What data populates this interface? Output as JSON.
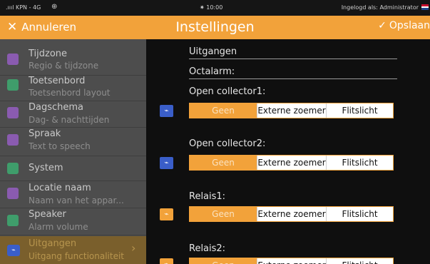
{
  "status_bar": {
    "carrier": ".ıııl KPN - 4G",
    "globe_icon": "globe-icon",
    "time": "10:00",
    "login_text": "Ingelogd als: Administrator"
  },
  "top_bar": {
    "cancel_label": "Annuleren",
    "title": "Instellingen",
    "save_label": "Opslaan"
  },
  "sidebar": {
    "items": [
      {
        "title": "Tijdzone",
        "subtitle": "Regio & tijdzone",
        "icon": "globe-icon",
        "color": "#8a5bb0"
      },
      {
        "title": "Toetsenbord",
        "subtitle": "Toetsenbord layout",
        "icon": "keyboard-icon",
        "color": "#3f9d6b"
      },
      {
        "title": "Dagschema",
        "subtitle": "Dag- & nachttijden",
        "icon": "sun-icon",
        "color": "#8a5bb0"
      },
      {
        "title": "Spraak",
        "subtitle": "Text to speech",
        "icon": "speech-icon",
        "color": "#8a5bb0"
      },
      {
        "title": "System",
        "subtitle": "",
        "icon": "system-icon",
        "color": "#3f9d6b"
      },
      {
        "title": "Locatie naam",
        "subtitle": "Naam van het appar...",
        "icon": "location-icon",
        "color": "#8a5bb0"
      },
      {
        "title": "Speaker",
        "subtitle": "Alarm volume",
        "icon": "speaker-icon",
        "color": "#3f9d6b"
      },
      {
        "title": "Uitgangen",
        "subtitle": "Uitgang functionaliteit",
        "icon": "output-icon",
        "color": "#3a5ec9"
      }
    ]
  },
  "main": {
    "section_title": "Uitgangen",
    "subsection_title": "Octalarm:",
    "outputs": [
      {
        "label": "Open collector1:",
        "icon_color": "#3a5ec9",
        "options": [
          "Geen",
          "Externe zoemer",
          "Flitslicht"
        ],
        "selected": "Geen"
      },
      {
        "label": "Open collector2:",
        "icon_color": "#3a5ec9",
        "options": [
          "Geen",
          "Externe zoemer",
          "Flitslicht"
        ],
        "selected": "Geen"
      },
      {
        "label": "Relais1:",
        "icon_color": "#f2a23a",
        "options": [
          "Geen",
          "Externe zoemer",
          "Flitslicht"
        ],
        "selected": "Geen"
      },
      {
        "label": "Relais2:",
        "icon_color": "#f2a23a",
        "options": [
          "Geen",
          "Externe zoemer",
          "Flitslicht"
        ],
        "selected": "Geen"
      }
    ]
  },
  "colors": {
    "accent": "#f2a23a",
    "sidebar_bg": "#4d4d4d",
    "main_bg": "#0f0f0f"
  }
}
